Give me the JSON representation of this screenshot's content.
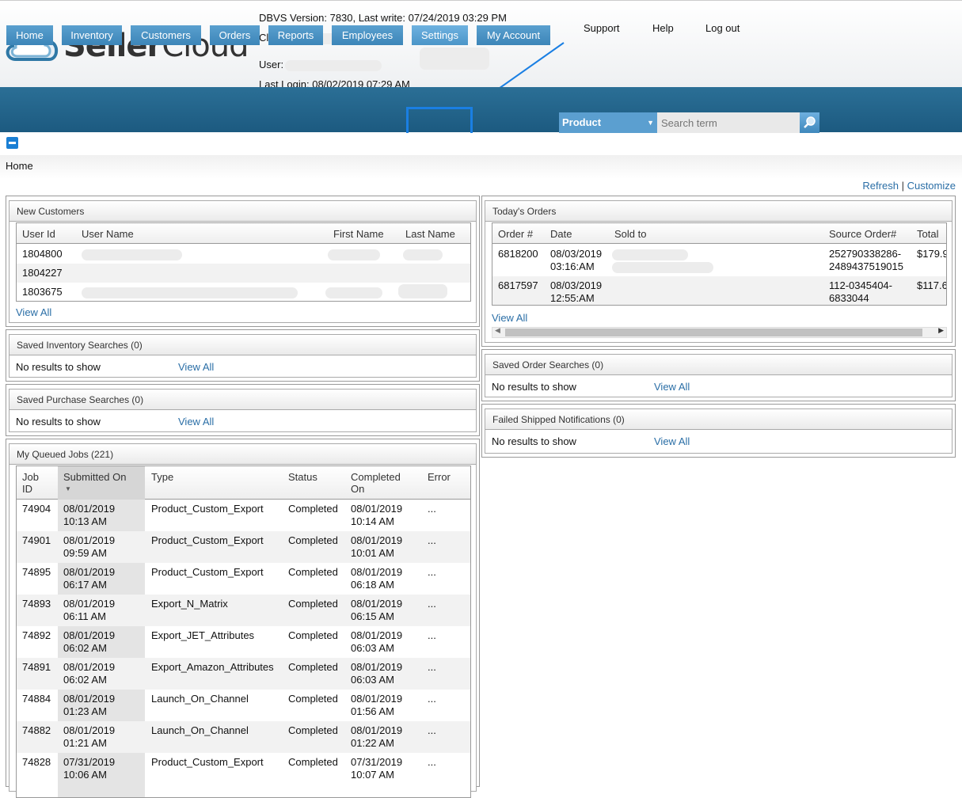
{
  "header": {
    "logo_text": "SellerCloud",
    "dbvs_line": "DBVS Version: 7830, Last write: 07/24/2019 03:29 PM",
    "client_label": "Client:",
    "user_label": "User:",
    "last_login": "Last Login: 08/02/2019 07:29 AM",
    "links": [
      "Support",
      "Help",
      "Log out"
    ]
  },
  "nav": {
    "tabs": [
      "Home",
      "Inventory",
      "Customers",
      "Orders",
      "Reports",
      "Employees",
      "Settings",
      "My Account"
    ],
    "search_type": "Product",
    "search_placeholder": "Search term",
    "highlighted_tab": "Settings"
  },
  "breadcrumb": "Home",
  "toolbar": {
    "refresh": "Refresh",
    "separator": "|",
    "customize": "Customize"
  },
  "new_customers": {
    "title": "New Customers",
    "columns": [
      "User Id",
      "User Name",
      "First Name",
      "Last Name"
    ],
    "rows": [
      {
        "user_id": "1804800"
      },
      {
        "user_id": "1804227"
      },
      {
        "user_id": "1803675"
      }
    ],
    "view_all": "View All"
  },
  "saved_inventory": {
    "title": "Saved Inventory Searches (0)",
    "empty": "No results to show",
    "view_all": "View All"
  },
  "saved_purchase": {
    "title": "Saved Purchase Searches (0)",
    "empty": "No results to show",
    "view_all": "View All"
  },
  "queued_jobs": {
    "title": "My Queued Jobs (221)",
    "columns": [
      "Job ID",
      "Submitted On",
      "Type",
      "Status",
      "Completed On",
      "Error"
    ],
    "column_lines": {
      "job": [
        "Job",
        "ID"
      ],
      "completed": [
        "Completed",
        "On"
      ]
    },
    "rows": [
      {
        "id": "74904",
        "sub_date": "08/01/2019",
        "sub_time": "10:13 AM",
        "type": "Product_Custom_Export",
        "status": "Completed",
        "comp_date": "08/01/2019",
        "comp_time": "10:14 AM",
        "error": "..."
      },
      {
        "id": "74901",
        "sub_date": "08/01/2019",
        "sub_time": "09:59 AM",
        "type": "Product_Custom_Export",
        "status": "Completed",
        "comp_date": "08/01/2019",
        "comp_time": "10:01 AM",
        "error": "..."
      },
      {
        "id": "74895",
        "sub_date": "08/01/2019",
        "sub_time": "06:17 AM",
        "type": "Product_Custom_Export",
        "status": "Completed",
        "comp_date": "08/01/2019",
        "comp_time": "06:18 AM",
        "error": "..."
      },
      {
        "id": "74893",
        "sub_date": "08/01/2019",
        "sub_time": "06:11 AM",
        "type": "Export_N_Matrix",
        "status": "Completed",
        "comp_date": "08/01/2019",
        "comp_time": "06:15 AM",
        "error": "..."
      },
      {
        "id": "74892",
        "sub_date": "08/01/2019",
        "sub_time": "06:02 AM",
        "type": "Export_JET_Attributes",
        "status": "Completed",
        "comp_date": "08/01/2019",
        "comp_time": "06:03 AM",
        "error": "..."
      },
      {
        "id": "74891",
        "sub_date": "08/01/2019",
        "sub_time": "06:02 AM",
        "type": "Export_Amazon_Attributes",
        "status": "Completed",
        "comp_date": "08/01/2019",
        "comp_time": "06:03 AM",
        "error": "..."
      },
      {
        "id": "74884",
        "sub_date": "08/01/2019",
        "sub_time": "01:23 AM",
        "type": "Launch_On_Channel",
        "status": "Completed",
        "comp_date": "08/01/2019",
        "comp_time": "01:56 AM",
        "error": "..."
      },
      {
        "id": "74882",
        "sub_date": "08/01/2019",
        "sub_time": "01:21 AM",
        "type": "Launch_On_Channel",
        "status": "Completed",
        "comp_date": "08/01/2019",
        "comp_time": "01:22 AM",
        "error": "..."
      },
      {
        "id": "74828",
        "sub_date": "07/31/2019",
        "sub_time": "10:06 AM",
        "type": "Product_Custom_Export",
        "status": "Completed",
        "comp_date": "07/31/2019",
        "comp_time": "10:07 AM",
        "error": "..."
      }
    ]
  },
  "todays_orders": {
    "title": "Today's Orders",
    "columns": [
      "Order #",
      "Date",
      "Sold to",
      "Source Order#",
      "Total"
    ],
    "rows": [
      {
        "order": "6818200",
        "date": "08/03/2019",
        "time": "03:16:AM",
        "source1": "252790338286-",
        "source2": "2489437519015",
        "total": "$179.9"
      },
      {
        "order": "6817597",
        "date": "08/03/2019",
        "time": "12:55:AM",
        "source1": "112-0345404-",
        "source2": "6833044",
        "total": "$117.6"
      }
    ],
    "view_all": "View All"
  },
  "saved_order": {
    "title": "Saved Order Searches (0)",
    "empty": "No results to show",
    "view_all": "View All"
  },
  "failed_shipped": {
    "title": "Failed Shipped Notifications (0)",
    "empty": "No results to show",
    "view_all": "View All"
  },
  "colors": {
    "nav_bg": "#1c5a80",
    "tab_bg": "#4a93c6",
    "link": "#2a6ea6",
    "highlight": "#1a7fe3"
  }
}
